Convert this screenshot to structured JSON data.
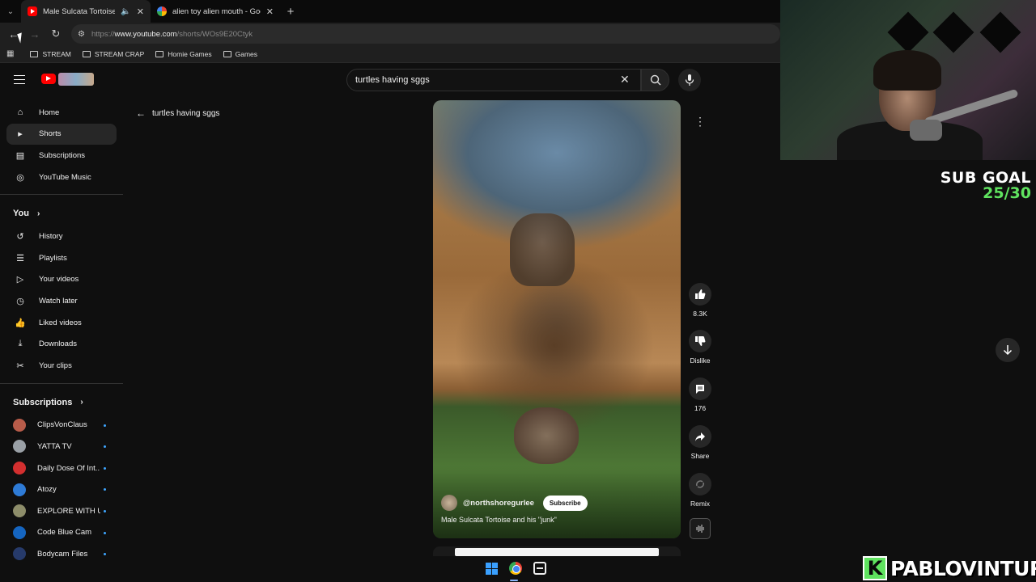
{
  "browser": {
    "tabs": [
      {
        "title": "Male Sulcata Tortoise and h",
        "icon": "youtube-favicon",
        "audio": true,
        "active": true
      },
      {
        "title": "alien toy alien mouth - Google",
        "icon": "google-favicon",
        "audio": false,
        "active": false
      }
    ],
    "url_prefix": "https://",
    "url_host": "www.youtube.com",
    "url_path": "/shorts/WOs9E20Ctyk",
    "bookmarks": [
      "STREAM",
      "STREAM CRAP",
      "Homie Games",
      "Games"
    ]
  },
  "header": {
    "search_value": "turtles having sggs"
  },
  "sidebar": {
    "main": [
      {
        "label": "Home",
        "icon": "home-icon"
      },
      {
        "label": "Shorts",
        "icon": "shorts-icon",
        "selected": true
      },
      {
        "label": "Subscriptions",
        "icon": "subscriptions-icon"
      },
      {
        "label": "YouTube Music",
        "icon": "music-icon"
      }
    ],
    "you_heading": "You",
    "you": [
      {
        "label": "History",
        "icon": "history-icon"
      },
      {
        "label": "Playlists",
        "icon": "playlists-icon"
      },
      {
        "label": "Your videos",
        "icon": "your-videos-icon"
      },
      {
        "label": "Watch later",
        "icon": "watch-later-icon"
      },
      {
        "label": "Liked videos",
        "icon": "like-icon"
      },
      {
        "label": "Downloads",
        "icon": "download-icon"
      },
      {
        "label": "Your clips",
        "icon": "scissors-icon"
      }
    ],
    "subs_heading": "Subscriptions",
    "subscriptions": [
      {
        "name": "ClipsVonClaus",
        "color": "#b85c4a"
      },
      {
        "name": "YATTA TV",
        "color": "#9aa0a6"
      },
      {
        "name": "Daily Dose Of Int...",
        "color": "#d32f2f"
      },
      {
        "name": "Atozy",
        "color": "#2e7bd6"
      },
      {
        "name": "EXPLORE WITH US",
        "color": "#8d8d6a"
      },
      {
        "name": "Code Blue Cam",
        "color": "#1565c0"
      },
      {
        "name": "Bodycam Files",
        "color": "#263a6a"
      }
    ]
  },
  "shorts": {
    "search_query": "turtles having sggs",
    "channel": "@northshoregurlee",
    "subscribe_label": "Subscribe",
    "caption": "Male Sulcata Tortoise and his \"junk\"",
    "likes": "8.3K",
    "dislike_label": "Dislike",
    "comments": "176",
    "share_label": "Share",
    "remix_label": "Remix"
  },
  "overlay": {
    "sub_goal_title": "SUB GOAL",
    "sub_goal_progress": "25/30",
    "brand_letter": "K",
    "brand_name": "PABLOVINTURA"
  }
}
